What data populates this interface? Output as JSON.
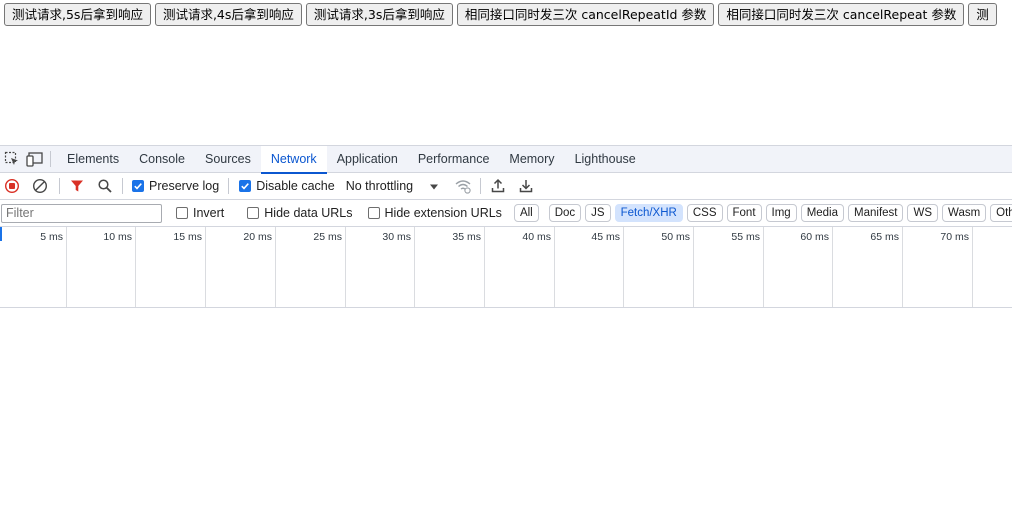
{
  "page": {
    "buttons": [
      "测试请求,5s后拿到响应",
      "测试请求,4s后拿到响应",
      "测试请求,3s后拿到响应",
      "相同接口同时发三次 cancelRepeatId 参数",
      "相同接口同时发三次 cancelRepeat 参数",
      "测"
    ]
  },
  "devtools": {
    "tabs": [
      "Elements",
      "Console",
      "Sources",
      "Network",
      "Application",
      "Performance",
      "Memory",
      "Lighthouse"
    ],
    "active_tab": "Network",
    "toolbar": {
      "preserve_log": "Preserve log",
      "preserve_log_checked": true,
      "disable_cache": "Disable cache",
      "disable_cache_checked": true,
      "throttling": "No throttling"
    },
    "filter": {
      "placeholder": "Filter",
      "invert": "Invert",
      "hide_data_urls": "Hide data URLs",
      "hide_extension_urls": "Hide extension URLs",
      "types": [
        "All",
        "Doc",
        "JS",
        "Fetch/XHR",
        "CSS",
        "Font",
        "Img",
        "Media",
        "Manifest",
        "WS",
        "Wasm",
        "Other"
      ],
      "active_type": "Fetch/XHR"
    },
    "timeline": {
      "ticks": [
        "5 ms",
        "10 ms",
        "15 ms",
        "20 ms",
        "25 ms",
        "30 ms",
        "35 ms",
        "40 ms",
        "45 ms",
        "50 ms",
        "55 ms",
        "60 ms",
        "65 ms",
        "70 ms"
      ]
    }
  },
  "colors": {
    "accent": "#0b57d0",
    "record_red": "#d93025",
    "filter_red": "#d93025",
    "checkbox_blue": "#1a73e8"
  }
}
